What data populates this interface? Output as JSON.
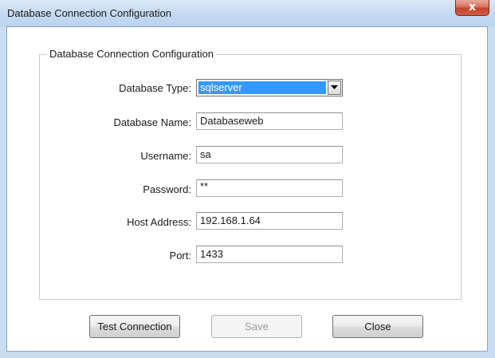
{
  "window": {
    "title": "Database Connection Configuration",
    "close_glyph": "x"
  },
  "group": {
    "legend": "Database Connection Configuration"
  },
  "fields": {
    "db_type": {
      "label": "Database Type:",
      "value": "sqlserver"
    },
    "db_name": {
      "label": "Database Name:",
      "value": "Databaseweb"
    },
    "username": {
      "label": "Username:",
      "value": "sa"
    },
    "password": {
      "label": "Password:",
      "value": "**"
    },
    "host": {
      "label": "Host Address:",
      "value": "192.168.1.64"
    },
    "port": {
      "label": "Port:",
      "value": "1433"
    }
  },
  "buttons": {
    "test": "Test Connection",
    "save": "Save",
    "close": "Close"
  },
  "icons": {
    "dropdown": "chevron-down-icon",
    "close": "close-icon"
  }
}
